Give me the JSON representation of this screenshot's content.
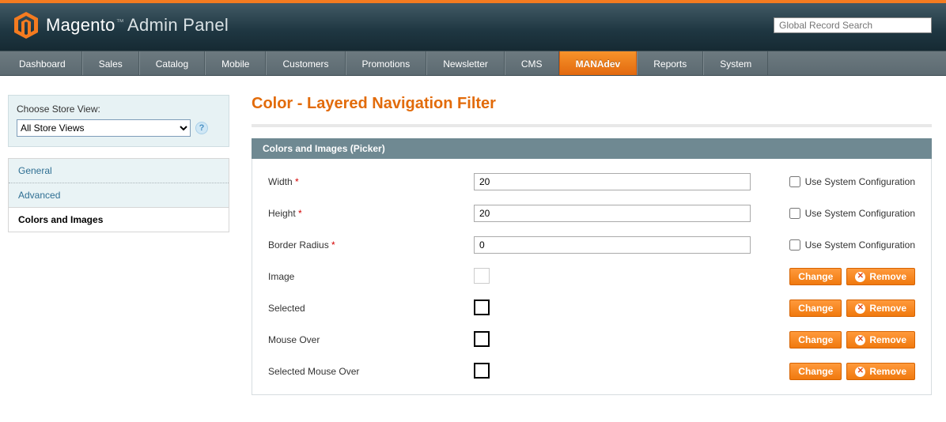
{
  "header": {
    "brand_main": "Magento",
    "brand_sub": "Admin Panel",
    "search_placeholder": "Global Record Search"
  },
  "nav": {
    "items": [
      "Dashboard",
      "Sales",
      "Catalog",
      "Mobile",
      "Customers",
      "Promotions",
      "Newsletter",
      "CMS",
      "MANAdev",
      "Reports",
      "System"
    ],
    "active_index": 8
  },
  "sidebar": {
    "store_view_label": "Choose Store View:",
    "store_view_value": "All Store Views",
    "tabs": [
      "General",
      "Advanced",
      "Colors and Images"
    ],
    "active_tab_index": 2
  },
  "main": {
    "title": "Color - Layered Navigation Filter",
    "section_title": "Colors and Images (Picker)",
    "sys_config_label": "Use System Configuration",
    "change_label": "Change",
    "remove_label": "Remove",
    "rows": [
      {
        "label": "Width",
        "required": true,
        "value": "20",
        "type": "text"
      },
      {
        "label": "Height",
        "required": true,
        "value": "20",
        "type": "text"
      },
      {
        "label": "Border Radius",
        "required": true,
        "value": "0",
        "type": "text"
      },
      {
        "label": "Image",
        "required": false,
        "type": "swatch",
        "bold": false
      },
      {
        "label": "Selected",
        "required": false,
        "type": "swatch",
        "bold": true
      },
      {
        "label": "Mouse Over",
        "required": false,
        "type": "swatch",
        "bold": true
      },
      {
        "label": "Selected Mouse Over",
        "required": false,
        "type": "swatch",
        "bold": true
      }
    ]
  }
}
